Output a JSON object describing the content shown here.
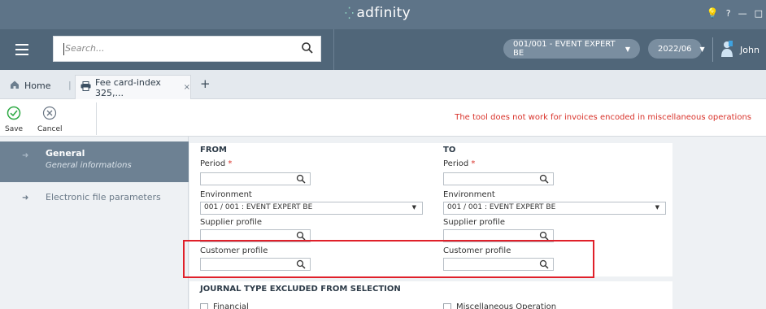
{
  "app": {
    "logo_text": "adfinity",
    "window_controls": [
      "?",
      "—",
      "□"
    ]
  },
  "toolbar": {
    "search_placeholder": "Search...",
    "company_label": "001/001 - EVENT EXPERT BE",
    "period_label": "2022/06",
    "user_name": "John"
  },
  "tabs": {
    "home_label": "Home",
    "active_tab_label": "Fee card-index 325,...",
    "close_symbol": "×",
    "add_symbol": "+"
  },
  "actions": {
    "save_label": "Save",
    "cancel_label": "Cancel",
    "warning_message": "The tool does not work for invoices encoded in miscellaneous operations",
    "warning_color": "#d9332b"
  },
  "sidebar": {
    "items": [
      {
        "title": "General",
        "subtitle": "General informations",
        "active": true
      },
      {
        "title": "Electronic file parameters",
        "active": false
      }
    ]
  },
  "form": {
    "from_header": "FROM",
    "to_header": "TO",
    "from": {
      "period_label": "Period",
      "environment_label": "Environment",
      "environment_value": "001 / 001 : EVENT EXPERT BE",
      "supplier_profile_label": "Supplier profile",
      "customer_profile_label": "Customer profile"
    },
    "to": {
      "period_label": "Period",
      "environment_label": "Environment",
      "environment_value": "001 / 001 : EVENT EXPERT BE",
      "supplier_profile_label": "Supplier profile",
      "customer_profile_label": "Customer profile"
    },
    "required_mark": "*",
    "journal_header": "JOURNAL TYPE EXCLUDED FROM SELECTION",
    "journal_options": [
      "Financial",
      "Miscellaneous Operation"
    ]
  },
  "colors": {
    "titlebar": "#5e7488",
    "toolbar": "#506679",
    "sidebar_active": "#6d8193",
    "accent_green": "#2eaa44",
    "highlight_red": "#e0202a"
  }
}
